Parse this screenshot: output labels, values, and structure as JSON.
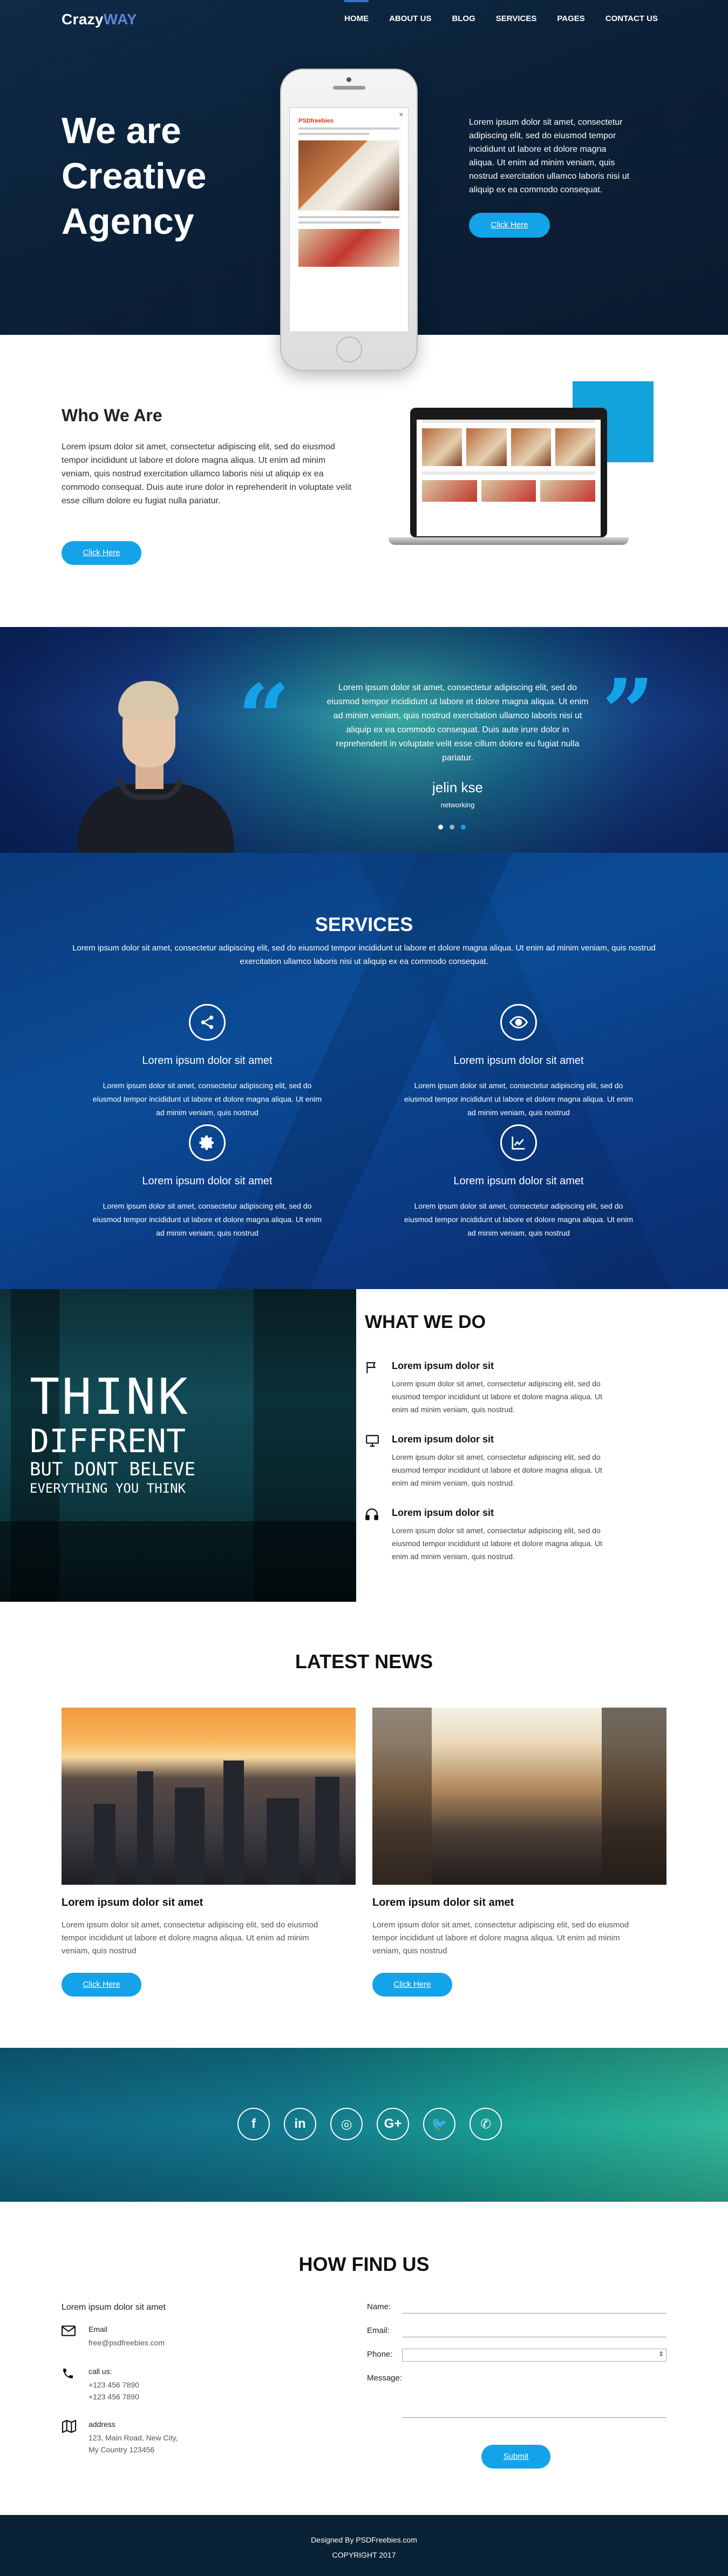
{
  "nav": {
    "logo_main": "Crazy",
    "logo_accent": "WAY",
    "items": [
      "HOME",
      "ABOUT US",
      "BLOG",
      "SERVICES",
      "PAGES",
      "CONTACT US"
    ]
  },
  "hero": {
    "title": "We are Creative Agency",
    "text": "Lorem ipsum dolor sit amet, consectetur adipiscing elit, sed do eiusmod tempor incididunt ut labore et dolore magna aliqua. Ut enim ad minim veniam, quis nostrud exercitation ullamco laboris nisi ut aliquip ex ea commodo consequat.",
    "button": "Click Here",
    "phone_logo": "PSDfreebies"
  },
  "who": {
    "title": "Who We Are",
    "text": "Lorem ipsum dolor sit amet, consectetur adipiscing elit, sed do eiusmod tempor incididunt ut labore et dolore magna aliqua. Ut enim ad minim veniam, quis nostrud exercitation ullamco laboris nisi ut aliquip ex ea commodo consequat. Duis aute irure dolor in reprehenderit in voluptate velit esse cillum dolore eu fugiat nulla pariatur.",
    "button": "Click Here"
  },
  "testimonial": {
    "text": "Lorem ipsum dolor sit amet, consectetur adipiscing elit, sed do eiusmod tempor incididunt ut labore et dolore magna aliqua. Ut enim ad minim veniam, quis nostrud exercitation ullamco laboris nisi ut aliquip ex ea commodo consequat. Duis aute irure dolor in reprehenderit in voluptate velit esse cillum dolore eu fugiat nulla pariatur.",
    "name": "jelin kse",
    "role": "networking"
  },
  "services": {
    "title": "SERVICES",
    "intro": "Lorem ipsum dolor sit amet, consectetur adipiscing elit, sed do eiusmod tempor incididunt ut labore et dolore magna aliqua. Ut enim ad minim veniam, quis nostrud exercitation ullamco laboris nisi ut aliquip ex ea commodo consequat.",
    "items": [
      {
        "icon": "share-icon",
        "title": "Lorem ipsum dolor sit amet",
        "text": "Lorem ipsum dolor sit amet, consectetur adipiscing elit, sed do eiusmod tempor incididunt ut labore et dolore magna aliqua. Ut enim ad minim veniam, quis nostrud"
      },
      {
        "icon": "eye-icon",
        "title": "Lorem ipsum dolor sit amet",
        "text": "Lorem ipsum dolor sit amet, consectetur adipiscing elit, sed do eiusmod tempor incididunt ut labore et dolore magna aliqua. Ut enim ad minim veniam, quis nostrud"
      },
      {
        "icon": "gear-icon",
        "title": "Lorem ipsum dolor sit amet",
        "text": "Lorem ipsum dolor sit amet, consectetur adipiscing elit, sed do eiusmod tempor incididunt ut labore et dolore magna aliqua. Ut enim ad minim veniam, quis nostrud"
      },
      {
        "icon": "chart-icon",
        "title": "Lorem ipsum dolor sit amet",
        "text": "Lorem ipsum dolor sit amet, consectetur adipiscing elit, sed do eiusmod tempor incididunt ut labore et dolore magna aliqua. Ut enim ad minim veniam, quis nostrud"
      }
    ]
  },
  "whatwedo": {
    "title": "WHAT WE DO",
    "image_text": [
      "THINK",
      "DIFFRENT",
      "BUT DONT BELEVE",
      "EVERYTHING YOU THINK"
    ],
    "items": [
      {
        "icon": "flag-icon",
        "title": "Lorem ipsum dolor sit",
        "text": "Lorem ipsum dolor sit amet, consectetur adipiscing elit, sed do eiusmod tempor incididunt ut labore et dolore magna aliqua. Ut enim ad minim veniam, quis nostrud."
      },
      {
        "icon": "monitor-icon",
        "title": "Lorem ipsum dolor sit",
        "text": "Lorem ipsum dolor sit amet, consectetur adipiscing elit, sed do eiusmod tempor incididunt ut labore et dolore magna aliqua. Ut enim ad minim veniam, quis nostrud."
      },
      {
        "icon": "headphones-icon",
        "title": "Lorem ipsum dolor sit",
        "text": "Lorem ipsum dolor sit amet, consectetur adipiscing elit, sed do eiusmod tempor incididunt ut labore et dolore magna aliqua. Ut enim ad minim veniam, quis nostrud."
      }
    ]
  },
  "news": {
    "title": "LATEST NEWS",
    "cards": [
      {
        "title": "Lorem ipsum dolor sit amet",
        "text": "Lorem ipsum dolor sit amet, consectetur adipiscing elit, sed do eiusmod tempor incididunt ut labore et dolore magna aliqua. Ut enim ad minim veniam, quis nostrud",
        "button": "Click Here"
      },
      {
        "title": "Lorem ipsum dolor sit amet",
        "text": "Lorem ipsum dolor sit amet, consectetur adipiscing elit, sed do eiusmod tempor incididunt ut labore et dolore magna aliqua. Ut enim ad minim veniam, quis nostrud",
        "button": "Click Here"
      }
    ]
  },
  "social": {
    "icons": [
      {
        "name": "facebook-icon",
        "glyph": "f"
      },
      {
        "name": "linkedin-icon",
        "glyph": "in"
      },
      {
        "name": "instagram-icon",
        "glyph": "◎"
      },
      {
        "name": "googleplus-icon",
        "glyph": "G+"
      },
      {
        "name": "twitter-icon",
        "glyph": "🐦"
      },
      {
        "name": "whatsapp-icon",
        "glyph": "✆"
      }
    ]
  },
  "find": {
    "title": "HOW FIND US",
    "subtitle": "Lorem ipsum dolor sit amet",
    "contacts": [
      {
        "icon": "mail-icon",
        "label": "Email",
        "value": "free@psdfreebies.com"
      },
      {
        "icon": "phone-icon",
        "label": "call us:",
        "value": "+123 456 7890\n+123 456 7890"
      },
      {
        "icon": "map-icon",
        "label": "address",
        "value": "123, Main Road, New City,\nMy Country 123456"
      }
    ],
    "form": {
      "name": "Name:",
      "email": "Email:",
      "phone": "Phone:",
      "message": "Message:",
      "submit": "Submit"
    }
  },
  "footer": {
    "designed": "Designed By PSDFreebies.com",
    "copyright": "COPYRIGHT 2017"
  },
  "colors": {
    "accent": "#14a3e8",
    "hero_bg": "#0e2a45",
    "services_bg": "#0b4c97",
    "footer_bg": "#0a2235"
  }
}
